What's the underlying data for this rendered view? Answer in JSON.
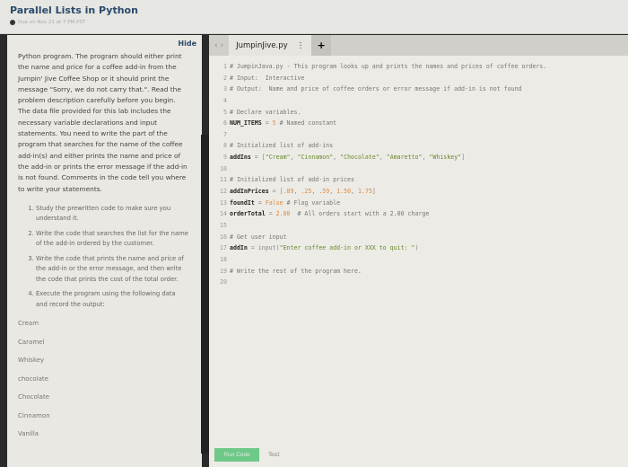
{
  "header": {
    "title": "Parallel Lists in Python",
    "due": "Due on Nov 21 at 7 PM PST"
  },
  "instructions": {
    "hide_label": "Hide",
    "paragraph": "Python program. The program should either print the name and price for a coffee add-in from the Jumpin' Jive Coffee Shop or it should print the message \"Sorry, we do not carry that.\". Read the problem description carefully before you begin. The data file provided for this lab includes the necessary variable declarations and input statements. You need to write the part of the program that searches for the name of the coffee add-in(s) and either prints the name and price of the add-in or prints the error message if the add-in is not found. Comments in the code tell you where to write your statements.",
    "steps": [
      "Study the prewritten code to make sure you understand it.",
      "Write the code that searches the list for the name of the add-in ordered by the customer.",
      "Write the code that prints the name and price of the add-in or the error message, and then write the code that prints the cost of the total order.",
      "Execute the program using the following data and record the output:"
    ],
    "data_items": [
      "Cream",
      "Caramel",
      "Whiskey",
      "chocolate",
      "Chocolate",
      "Cinnamon",
      "Vanilla"
    ]
  },
  "editor": {
    "tab_name": "JumpinJive.py",
    "buttons": {
      "run": "Run Code",
      "test": "Test"
    },
    "lines": [
      [
        {
          "t": "# JumpinJava.py - This program looks up and prints the names and prices of coffee orders.",
          "c": "c"
        }
      ],
      [
        {
          "t": "# Input:  Interactive",
          "c": "c"
        }
      ],
      [
        {
          "t": "# Output:  Name and price of coffee orders or error message if add-in is not found",
          "c": "c"
        }
      ],
      [],
      [
        {
          "t": "# Declare variables.",
          "c": "c"
        }
      ],
      [
        {
          "t": "NUM_ITEMS",
          "c": "k"
        },
        {
          "t": " = ",
          "c": "o"
        },
        {
          "t": "5",
          "c": "n"
        },
        {
          "t": " # Named constant",
          "c": "c"
        }
      ],
      [],
      [
        {
          "t": "# Initialized list of add-ins",
          "c": "c"
        }
      ],
      [
        {
          "t": "addIns",
          "c": "k"
        },
        {
          "t": " = [",
          "c": "o"
        },
        {
          "t": "\"Cream\"",
          "c": "s"
        },
        {
          "t": ", ",
          "c": "o"
        },
        {
          "t": "\"Cinnamon\"",
          "c": "s"
        },
        {
          "t": ", ",
          "c": "o"
        },
        {
          "t": "\"Chocolate\"",
          "c": "s"
        },
        {
          "t": ", ",
          "c": "o"
        },
        {
          "t": "\"Amaretto\"",
          "c": "s"
        },
        {
          "t": ", ",
          "c": "o"
        },
        {
          "t": "\"Whiskey\"",
          "c": "s"
        },
        {
          "t": "]",
          "c": "o"
        }
      ],
      [],
      [
        {
          "t": "# Initialized list of add-in prices",
          "c": "c"
        }
      ],
      [
        {
          "t": "addInPrices",
          "c": "k"
        },
        {
          "t": " = [",
          "c": "o"
        },
        {
          "t": ".89",
          "c": "n"
        },
        {
          "t": ", ",
          "c": "o"
        },
        {
          "t": ".25",
          "c": "n"
        },
        {
          "t": ", ",
          "c": "o"
        },
        {
          "t": ".59",
          "c": "n"
        },
        {
          "t": ", ",
          "c": "o"
        },
        {
          "t": "1.50",
          "c": "n"
        },
        {
          "t": ", ",
          "c": "o"
        },
        {
          "t": "1.75",
          "c": "n"
        },
        {
          "t": "]",
          "c": "o"
        }
      ],
      [
        {
          "t": "foundIt",
          "c": "k"
        },
        {
          "t": " = ",
          "c": "o"
        },
        {
          "t": "False",
          "c": "n"
        },
        {
          "t": " # Flag variable",
          "c": "c"
        }
      ],
      [
        {
          "t": "orderTotal",
          "c": "k"
        },
        {
          "t": " = ",
          "c": "o"
        },
        {
          "t": "2.00",
          "c": "n"
        },
        {
          "t": "  # All orders start with a 2.00 charge",
          "c": "c"
        }
      ],
      [],
      [
        {
          "t": "# Get user input",
          "c": "c"
        }
      ],
      [
        {
          "t": "addIn",
          "c": "k"
        },
        {
          "t": " = input(",
          "c": "o"
        },
        {
          "t": "\"Enter coffee add-in or XXX to quit: \"",
          "c": "s"
        },
        {
          "t": ")",
          "c": "o"
        }
      ],
      [],
      [
        {
          "t": "# Write the rest of the program here.",
          "c": "c"
        }
      ],
      []
    ]
  }
}
